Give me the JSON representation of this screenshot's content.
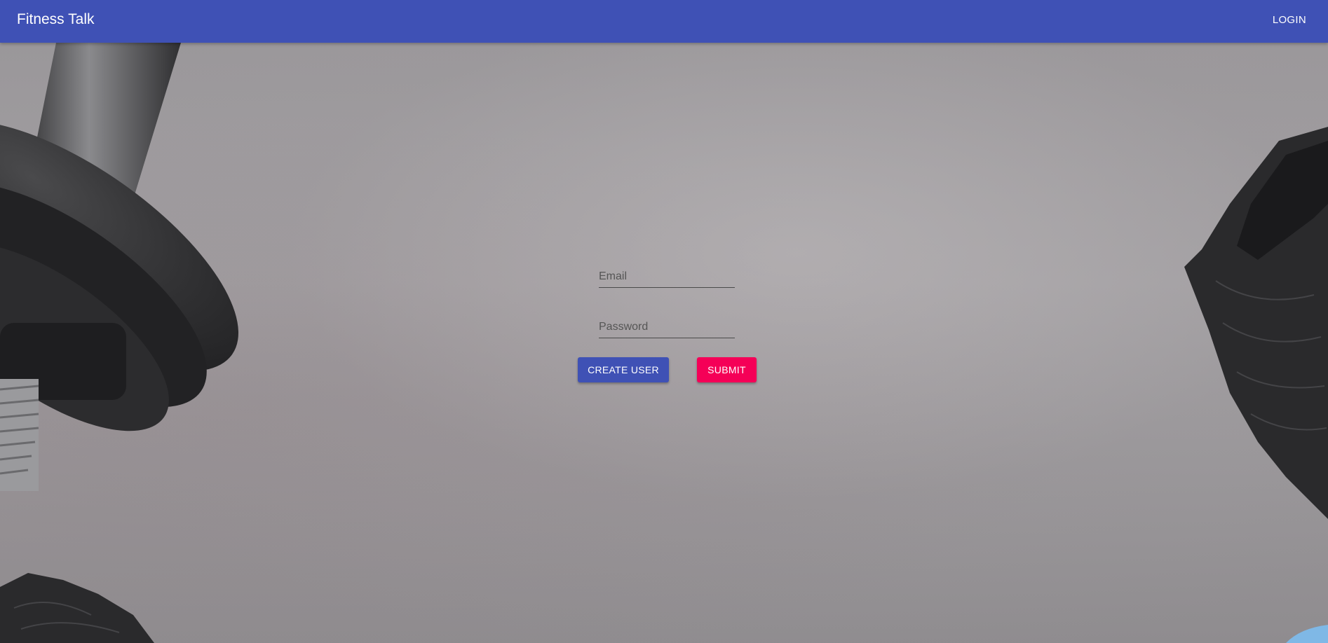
{
  "appbar": {
    "title": "Fitness Talk",
    "login_label": "LOGIN"
  },
  "form": {
    "email_placeholder": "Email",
    "password_placeholder": "Password",
    "create_user_label": "CREATE USER",
    "submit_label": "SUBMIT"
  },
  "colors": {
    "appbar": "#3f51b5",
    "create_button": "#3f51b5",
    "submit_button": "#f50057"
  },
  "background": {
    "icon": "gym-equipment-background"
  }
}
